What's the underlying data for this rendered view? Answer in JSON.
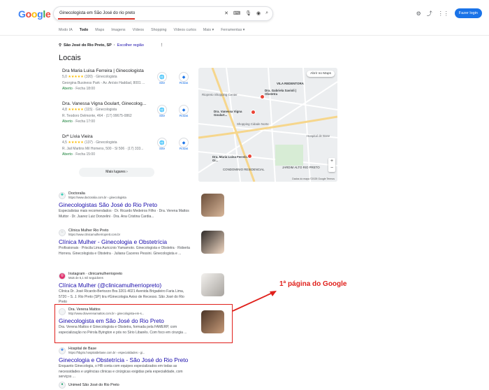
{
  "header": {
    "logo": "Google",
    "query": "Ginecologista em São José do rio preto",
    "login": "Fazer login",
    "logo_colors": [
      "#4285f4",
      "#ea4335",
      "#fbbc05",
      "#4285f4",
      "#34a853",
      "#ea4335"
    ]
  },
  "tabs": [
    "Modo IA",
    "Todo",
    "Maps",
    "Imagens",
    "Vídeos",
    "Shopping",
    "Vídeos curtos",
    "Mais ▾",
    "Ferramentas ▾"
  ],
  "location": {
    "text": "São José do Rio Preto, SP",
    "link": "Escolher região"
  },
  "locais": {
    "title": "Locais",
    "places": [
      {
        "name": "Dra Maria Luisa Ferreira | Ginecologista",
        "rating": "5,0",
        "reviews": "(320)",
        "type": "Ginecologista",
        "address": "Georgina Business Park - Av. Anísio Haddad, 8001 ...",
        "status": "Aberto",
        "hours": "Fecha 18:00",
        "site": "Site",
        "rotas": "Rotas"
      },
      {
        "name": "Dra. Vanessa Vigna Goulart, Ginecolog...",
        "rating": "4,8",
        "reviews": "(115)",
        "type": "Ginecologista",
        "address": "R. Teodoro Delmonte, 464 · (17) 99675-0862",
        "status": "Aberto",
        "hours": "Fecha 17:00",
        "site": "Site",
        "rotas": "Rotas"
      },
      {
        "name": "Drª Lívia Vieira",
        "rating": "4,5",
        "reviews": "(137)",
        "type": "Ginecologista",
        "address": "R. Jail Martins Mil Homens, 500 - Sl 506 · (17) 333...",
        "status": "Aberto",
        "hours": "Fecha 15:00",
        "site": "Site",
        "rotas": "Rotas"
      }
    ],
    "more": "Mais lugares ›"
  },
  "map": {
    "open": "Abrir no Maps",
    "footer": "Dados do mapa ©2025 Google   Termos",
    "labels": [
      "VILA REDENTORA",
      "Dra. Vanessa Vigna Goulart...",
      "Dra. Gabriela Savioli | Obstetra",
      "Dra. Maria Luisa Ferreira | Gi...",
      "CONDOMINIO RESIDENCIAL",
      "Shopping Cidade Norte",
      "Riopreto Shopping Center",
      "Hospital de Base",
      "JARDIM ALTO RIO PRETO"
    ]
  },
  "results": [
    {
      "site": "Doctoralia",
      "url": "https://www.doctoralia.com.br › ginecologista",
      "title": "Ginecologistas São José do Rio Preto",
      "snippet": "Especialistas mais recomendados · Dr. Ricardo Medeiros Filho · Dra. Verena Mattos Muttor · Dr. Juarez Luiz Donzelini · Dra. Ana Cristina Cardia..."
    },
    {
      "site": "Clínica Mulher Rio Preto",
      "url": "https://www.clinicamulherrioprett.com.br",
      "title": "Clínica Mulher - Ginecologia e Obstetrícia",
      "snippet": "Profissionais · Priscila Lima Auriccnio Yamamoto. Ginecologista e Obstetra · Roberta Horrera. Ginecologista e Obstetra · Juliana Caceres Pessini. Ginecologista e ..."
    },
    {
      "site": "Instagram · clinicamulherriopreto",
      "url": "Mais de 5,1 mil seguidores",
      "title": "Clínica Mulher (@clinicamulherriopreto)",
      "snippet": "Clínica Dr. José Ricardo-Bertozzo Bra 3201-4021 Avenida Brigadeiro Faria Lima, 5720 – S. J. Rio Preto (SP) tira #Ginecologia Aviso de Recesso. São José do Rio Preto"
    },
    {
      "site": "Dra. Verena Mattos",
      "url": "http://www.draverenamattos.com.br › ginecologista-em-s...",
      "title": "Ginecologista em São José do Rio Preto",
      "snippet": "Dra. Verena Mattos é Ginecologista e Obstetra, formada pela FAMERP, com especialização no Pérola Byington e pós no Sírio Libanês. Com foco em cirurgia ..."
    },
    {
      "site": "Hospital de Base",
      "url": "https://hbgrio.hospitaldebase.com.br › especialidades › gi...",
      "title": "Ginecologia e Obstetrícia - São José do Rio Preto",
      "snippet": "Enquanto Ginecologia, o HB conta com equipes especializados em todas as necessidades e urgências clínicas e cirúrgicas exigidas pela especialidade, com serviços ..."
    },
    {
      "site": "Unimed São José do Rio Preto",
      "url": "",
      "title": "",
      "snippet": ""
    }
  ],
  "annotation": "1ª página do Google"
}
